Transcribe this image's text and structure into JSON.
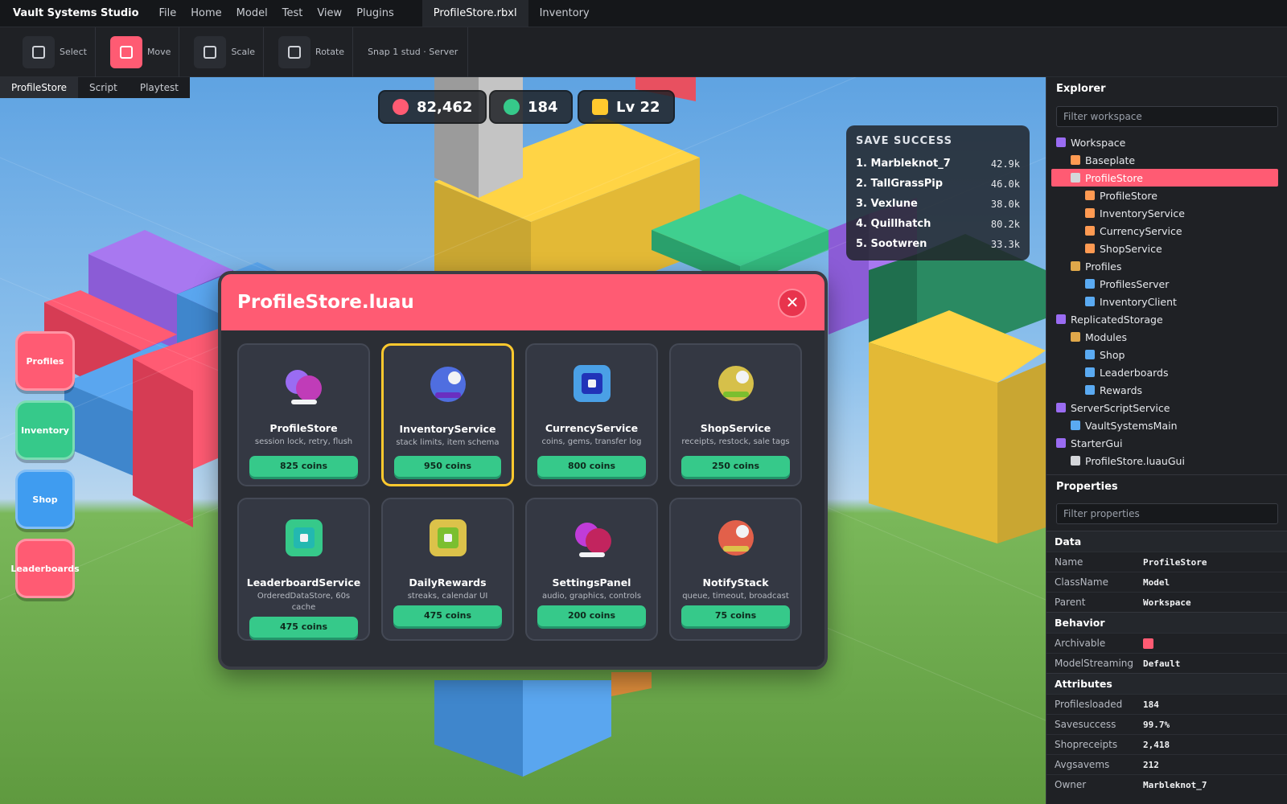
{
  "app": {
    "title": "Vault Systems Studio"
  },
  "menu": [
    "File",
    "Home",
    "Model",
    "Test",
    "View",
    "Plugins"
  ],
  "file_tabs": {
    "active": "ProfileStore.rbxl",
    "other": "Inventory"
  },
  "toolbar": {
    "tools": [
      {
        "label": "Select",
        "active": false
      },
      {
        "label": "Move",
        "active": true
      },
      {
        "label": "Scale",
        "active": false
      },
      {
        "label": "Rotate",
        "active": false
      }
    ],
    "snap": "Snap 1 stud · Server"
  },
  "viewport_tabs": [
    "ProfileStore",
    "Script",
    "Playtest"
  ],
  "hud": {
    "coins": "82,462",
    "gems": "184",
    "level": "Lv 22"
  },
  "leaderboard": {
    "title": "SAVE SUCCESS",
    "rows": [
      {
        "name": "1. Marbleknot_7",
        "value": "42.9k"
      },
      {
        "name": "2. TallGrassPip",
        "value": "46.0k"
      },
      {
        "name": "3. Vexlune",
        "value": "38.0k"
      },
      {
        "name": "4. Quillhatch",
        "value": "80.2k"
      },
      {
        "name": "5. Sootwren",
        "value": "33.3k"
      }
    ]
  },
  "side_buttons": [
    {
      "label": "Profiles",
      "color": "#ff5b73"
    },
    {
      "label": "Inventory",
      "color": "#36c98a"
    },
    {
      "label": "Shop",
      "color": "#3f9cf0"
    },
    {
      "label": "Leaderboards",
      "color": "#ff5b73"
    }
  ],
  "modal": {
    "title": "ProfileStore.luau",
    "close": "✕",
    "cards": [
      {
        "name": "ProfileStore",
        "desc": "session lock, retry, flush",
        "price": "825 coins",
        "icon": "two-circles-icon",
        "selected": false
      },
      {
        "name": "InventoryService",
        "desc": "stack limits, item schema",
        "price": "950 coins",
        "icon": "orb-icon",
        "selected": true
      },
      {
        "name": "CurrencyService",
        "desc": "coins, gems, transfer log",
        "price": "800 coins",
        "icon": "square-target-icon",
        "selected": false
      },
      {
        "name": "ShopService",
        "desc": "receipts, restock, sale tags",
        "price": "250 coins",
        "icon": "orb-icon",
        "selected": false
      },
      {
        "name": "LeaderboardService",
        "desc": "OrderedDataStore, 60s cache",
        "price": "475 coins",
        "icon": "square-target-icon",
        "selected": false
      },
      {
        "name": "DailyRewards",
        "desc": "streaks, calendar UI",
        "price": "475 coins",
        "icon": "square-target-icon",
        "selected": false
      },
      {
        "name": "SettingsPanel",
        "desc": "audio, graphics, controls",
        "price": "200 coins",
        "icon": "two-circles-icon",
        "selected": false
      },
      {
        "name": "NotifyStack",
        "desc": "queue, timeout, broadcast",
        "price": "75 coins",
        "icon": "orb-icon",
        "selected": false
      }
    ]
  },
  "explorer": {
    "title": "Explorer",
    "filter_placeholder": "Filter workspace",
    "items": [
      {
        "label": "Workspace",
        "depth": 0,
        "color": "#9a6cf2"
      },
      {
        "label": "Baseplate",
        "depth": 1,
        "color": "#ff9a52"
      },
      {
        "label": "ProfileStore",
        "depth": 1,
        "color": "#d4d6da",
        "selected": true
      },
      {
        "label": "ProfileStore",
        "depth": 2,
        "color": "#ff9a52"
      },
      {
        "label": "InventoryService",
        "depth": 2,
        "color": "#ff9a52"
      },
      {
        "label": "CurrencyService",
        "depth": 2,
        "color": "#ff9a52"
      },
      {
        "label": "ShopService",
        "depth": 2,
        "color": "#ff9a52"
      },
      {
        "label": "Profiles",
        "depth": 1,
        "color": "#e0a84a"
      },
      {
        "label": "ProfilesServer",
        "depth": 2,
        "color": "#5aaaf2"
      },
      {
        "label": "InventoryClient",
        "depth": 2,
        "color": "#5aaaf2"
      },
      {
        "label": "ReplicatedStorage",
        "depth": 0,
        "color": "#9a6cf2"
      },
      {
        "label": "Modules",
        "depth": 1,
        "color": "#e0a84a"
      },
      {
        "label": "Shop",
        "depth": 2,
        "color": "#5aaaf2"
      },
      {
        "label": "Leaderboards",
        "depth": 2,
        "color": "#5aaaf2"
      },
      {
        "label": "Rewards",
        "depth": 2,
        "color": "#5aaaf2"
      },
      {
        "label": "ServerScriptService",
        "depth": 0,
        "color": "#9a6cf2"
      },
      {
        "label": "VaultSystemsMain",
        "depth": 1,
        "color": "#5aaaf2"
      },
      {
        "label": "StarterGui",
        "depth": 0,
        "color": "#9a6cf2"
      },
      {
        "label": "ProfileStore.luauGui",
        "depth": 1,
        "color": "#d4d6da"
      }
    ]
  },
  "properties": {
    "title": "Properties",
    "filter_placeholder": "Filter properties",
    "sections": [
      {
        "title": "Data",
        "rows": [
          {
            "key": "Name",
            "value": "ProfileStore"
          },
          {
            "key": "ClassName",
            "value": "Model"
          },
          {
            "key": "Parent",
            "value": "Workspace"
          }
        ]
      },
      {
        "title": "Behavior",
        "rows": [
          {
            "key": "Archivable",
            "value": "",
            "swatch": "#ff5b73"
          },
          {
            "key": "ModelStreaming",
            "value": "Default"
          }
        ]
      },
      {
        "title": "Attributes",
        "rows": [
          {
            "key": "Profilesloaded",
            "value": "184"
          },
          {
            "key": "Savesuccess",
            "value": "99.7%"
          },
          {
            "key": "Shopreceipts",
            "value": "2,418"
          },
          {
            "key": "Avgsavems",
            "value": "212"
          },
          {
            "key": "Owner",
            "value": "Marbleknot_7"
          }
        ]
      }
    ]
  }
}
